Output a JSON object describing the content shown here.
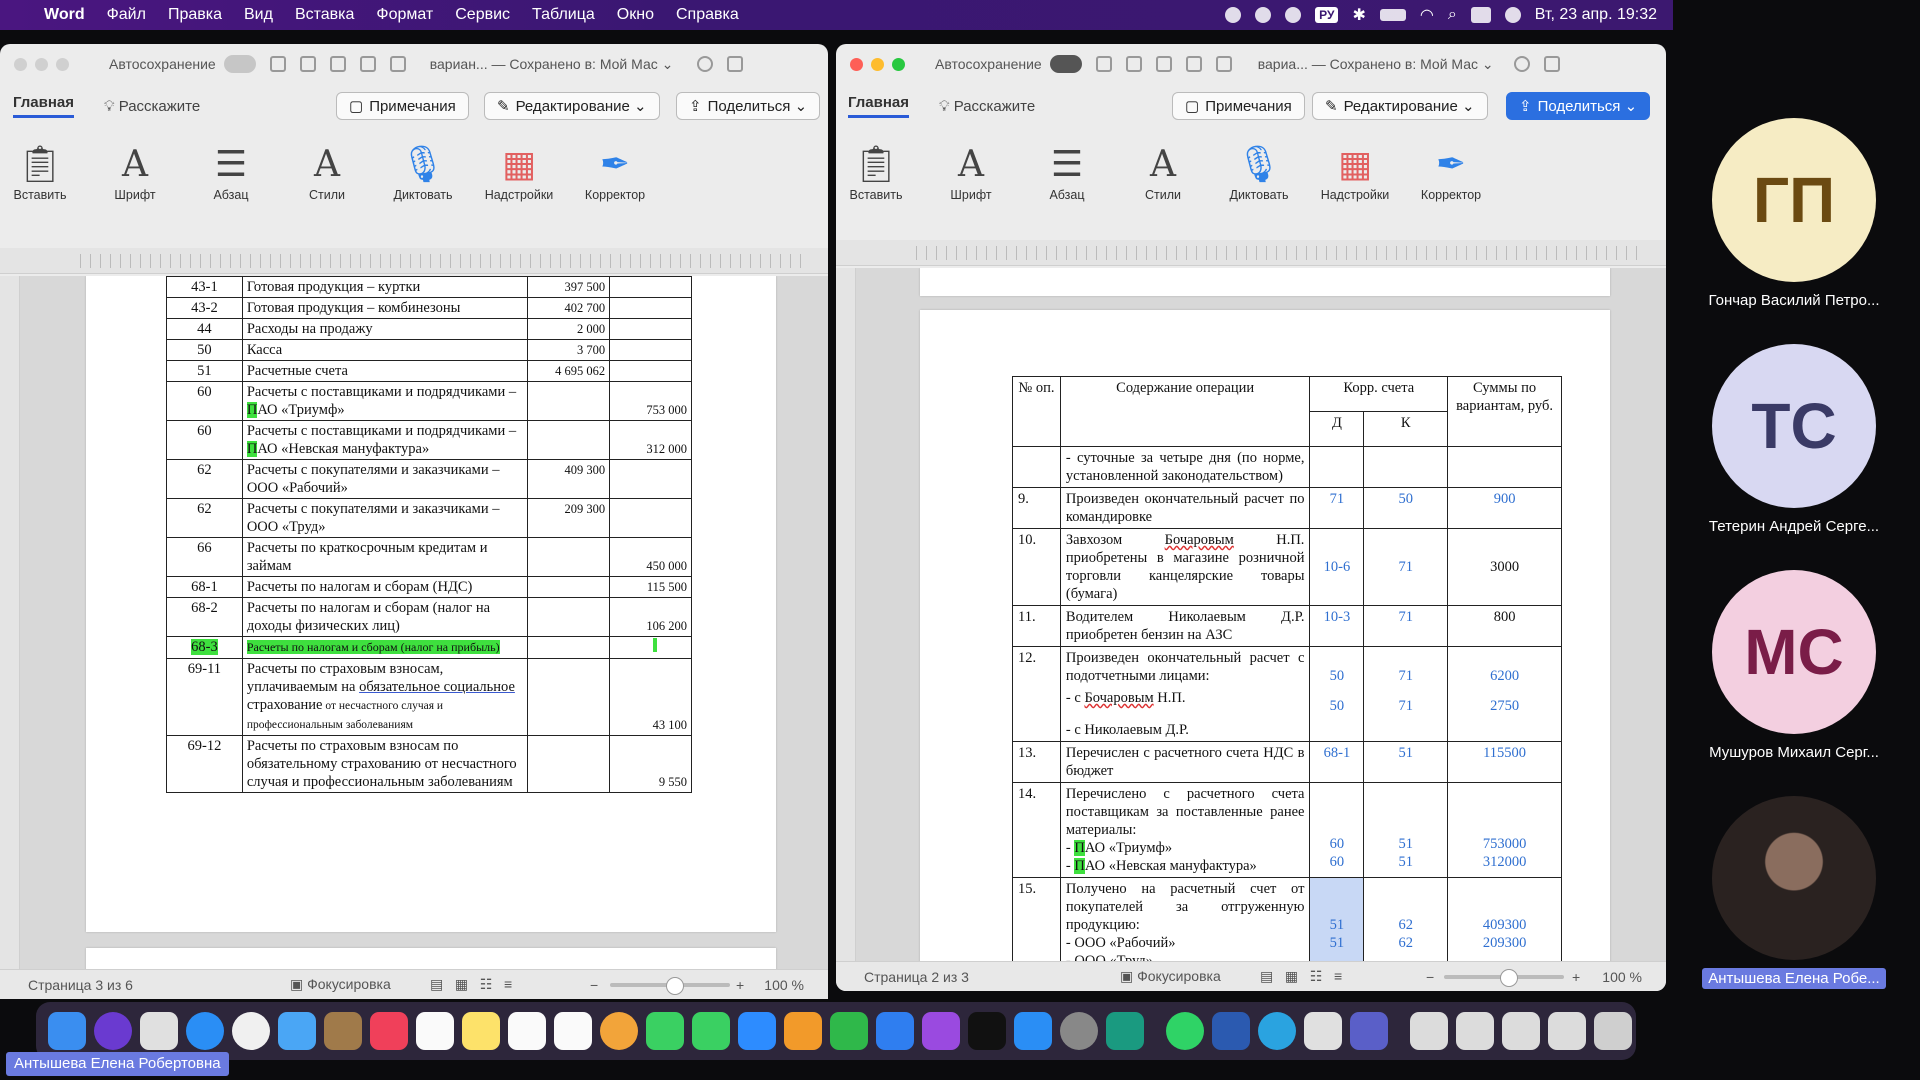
{
  "menubar": {
    "app": "Word",
    "items": [
      "Файл",
      "Правка",
      "Вид",
      "Вставка",
      "Формат",
      "Сервис",
      "Таблица",
      "Окно",
      "Справка"
    ],
    "lang": "РУ",
    "datetime": "Вт, 23 апр. 19:32"
  },
  "left": {
    "autosave": "Автосохранение",
    "doc_title": "вариан... — Сохранено в: Мой Мас ⌄",
    "tab_home": "Главная",
    "tell_me": "Расскажите",
    "btn_comments": "Примечания",
    "btn_edit": "Редактирование",
    "btn_share": "Поделиться",
    "ribbon": [
      "Вставить",
      "Шрифт",
      "Абзац",
      "Стили",
      "Диктовать",
      "Надстройки",
      "Корректор"
    ],
    "status_page": "Страница 3 из 6",
    "status_focus": "Фокусировка",
    "zoom": "100 %",
    "rows": [
      {
        "acc": "43-1",
        "name": "Готовая продукция – куртки",
        "d": "397 500",
        "k": ""
      },
      {
        "acc": "43-2",
        "name": "Готовая продукция – комбинезоны",
        "d": "402 700",
        "k": ""
      },
      {
        "acc": "44",
        "name": "Расходы на продажу",
        "d": "2 000",
        "k": ""
      },
      {
        "acc": "50",
        "name": "Касса",
        "d": "3 700",
        "k": ""
      },
      {
        "acc": "51",
        "name": "Расчетные счета",
        "d": "4 695 062",
        "k": ""
      },
      {
        "acc": "60",
        "name_a": "Расчеты с поставщиками и подрядчиками – ",
        "name_hl": "П",
        "name_b": "АО «Триумф»",
        "d": "",
        "k": "753 000"
      },
      {
        "acc": "60",
        "name_a": "Расчеты с поставщиками и подрядчиками – ",
        "name_hl": "П",
        "name_b": "АО «Невская мануфактура»",
        "d": "",
        "k": "312 000"
      },
      {
        "acc": "62",
        "name": "Расчеты с покупателями и заказчиками – ООО «Рабочий»",
        "d": "409 300",
        "k": ""
      },
      {
        "acc": "62",
        "name": "Расчеты с покупателями и заказчиками – ООО «Труд»",
        "d": "209 300",
        "k": ""
      },
      {
        "acc": "66",
        "name": "Расчеты по краткосрочным кредитам и займам",
        "d": "",
        "k": "450 000"
      },
      {
        "acc": "68-1",
        "name": "Расчеты по налогам и сборам (НДС)",
        "d": "",
        "k": "115 500"
      },
      {
        "acc": "68-2",
        "name": "Расчеты по налогам и сборам (налог на доходы физических лиц)",
        "d": "",
        "k": "106 200"
      },
      {
        "acc": "68-3",
        "name": "Расчеты по налогам и сборам (налог на прибыль)",
        "d": "",
        "k": ""
      },
      {
        "acc": "69-11",
        "name_a": "Расчеты по страховым взносам, уплачиваемым на ",
        "name_u": "обязательное социальное",
        "name_b": " страхование",
        "name_s": " от несчастного случая и профессиональным заболеваниям",
        "d": "",
        "k": "43 100"
      },
      {
        "acc": "69-12",
        "name": "Расчеты по страховым взносам по обязательному страхованию от несчастного случая и профессиональным заболеваниям",
        "d": "",
        "k": "9 550"
      }
    ]
  },
  "right": {
    "autosave": "Автосохранение",
    "doc_title": "вариа... — Сохранено в: Мой Мас ⌄",
    "tab_home": "Главная",
    "tell_me": "Расскажите",
    "btn_comments": "Примечания",
    "btn_edit": "Редактирование",
    "btn_share": "Поделиться",
    "ribbon": [
      "Вставить",
      "Шрифт",
      "Абзац",
      "Стили",
      "Диктовать",
      "Надстройки",
      "Корректор"
    ],
    "status_page": "Страница 2 из 3",
    "status_focus": "Фокусировка",
    "zoom": "100 %",
    "head": {
      "num": "№ оп.",
      "content": "Содержание операции",
      "corr": "Корр. счета",
      "d": "Д",
      "k": "К",
      "sum": "Суммы по вариантам, руб."
    },
    "ops": [
      {
        "n": "",
        "text": "- суточные за четыре дня (по норме, установленной законодательством)",
        "d": "",
        "k": "",
        "s": ""
      },
      {
        "n": "9.",
        "text": "Произведен окончательный расчет по командировке",
        "d": "71",
        "k": "50",
        "s": "900"
      },
      {
        "n": "10.",
        "text_a": "Завхозом ",
        "text_u": "Бочаровым",
        "text_b": " Н.П. приобретены в магазине розничной торговли канцелярские товары (бумага)",
        "d": "10-6",
        "k": "71",
        "s": "3000"
      },
      {
        "n": "11.",
        "text": "Водителем Николаевым Д.Р. приобретен бензин на АЗС",
        "d": "10-3",
        "k": "71",
        "s": "800"
      },
      {
        "n": "12.",
        "text": "Произведен окончательный расчет с подотчетными лицами:",
        "l1a": "- с ",
        "l1u": "Бочаровым",
        "l1b": " Н.П.",
        "l2": "- с Николаевым Д.Р.",
        "d1": "50",
        "k1": "71",
        "s1": "6200",
        "d2": "50",
        "k2": "71",
        "s2": "2750"
      },
      {
        "n": "13.",
        "text": "Перечислен с расчетного счета НДС в бюджет",
        "d": "68-1",
        "k": "51",
        "s": "115500"
      },
      {
        "n": "14.",
        "text": "Перечислено с расчетного счета поставщикам за поставленные ранее материалы:",
        "l1": "АО «Триумф»",
        "l2": "АО «Невская мануфактура»",
        "d1": "60",
        "k1": "51",
        "s1": "753000",
        "d2": "60",
        "k2": "51",
        "s2": "312000"
      },
      {
        "n": "15.",
        "text": "Получено на расчетный счет от покупателей за отгруженную продукцию:",
        "l1": "- ООО «Рабочий»",
        "l2": "- ООО «Труд»",
        "d1": "51",
        "k1": "62",
        "s1": "409300",
        "d2": "51",
        "k2": "62",
        "s2": "209300"
      }
    ]
  },
  "participants": [
    {
      "initials": "ГП",
      "name": "Гончар Василий Петро...",
      "bg": "#f6ecc4",
      "fg": "#6b4a12"
    },
    {
      "initials": "ТС",
      "name": "Тетерин Андрей Серге...",
      "bg": "#d8d8f2",
      "fg": "#3a3a66"
    },
    {
      "initials": "МС",
      "name": "Мушуров Михаил Серг...",
      "bg": "#f3cfe0",
      "fg": "#7a1d48"
    },
    {
      "initials": "",
      "name": "Антышева Елена Робе...",
      "bg": "#5a4a44",
      "fg": "#fff"
    }
  ],
  "speaker_name": "Антышева Елена Робертовна",
  "colors": {
    "accent": "#2b6fe0",
    "highlight": "#3ee03e",
    "menubar": "#3a1772"
  }
}
